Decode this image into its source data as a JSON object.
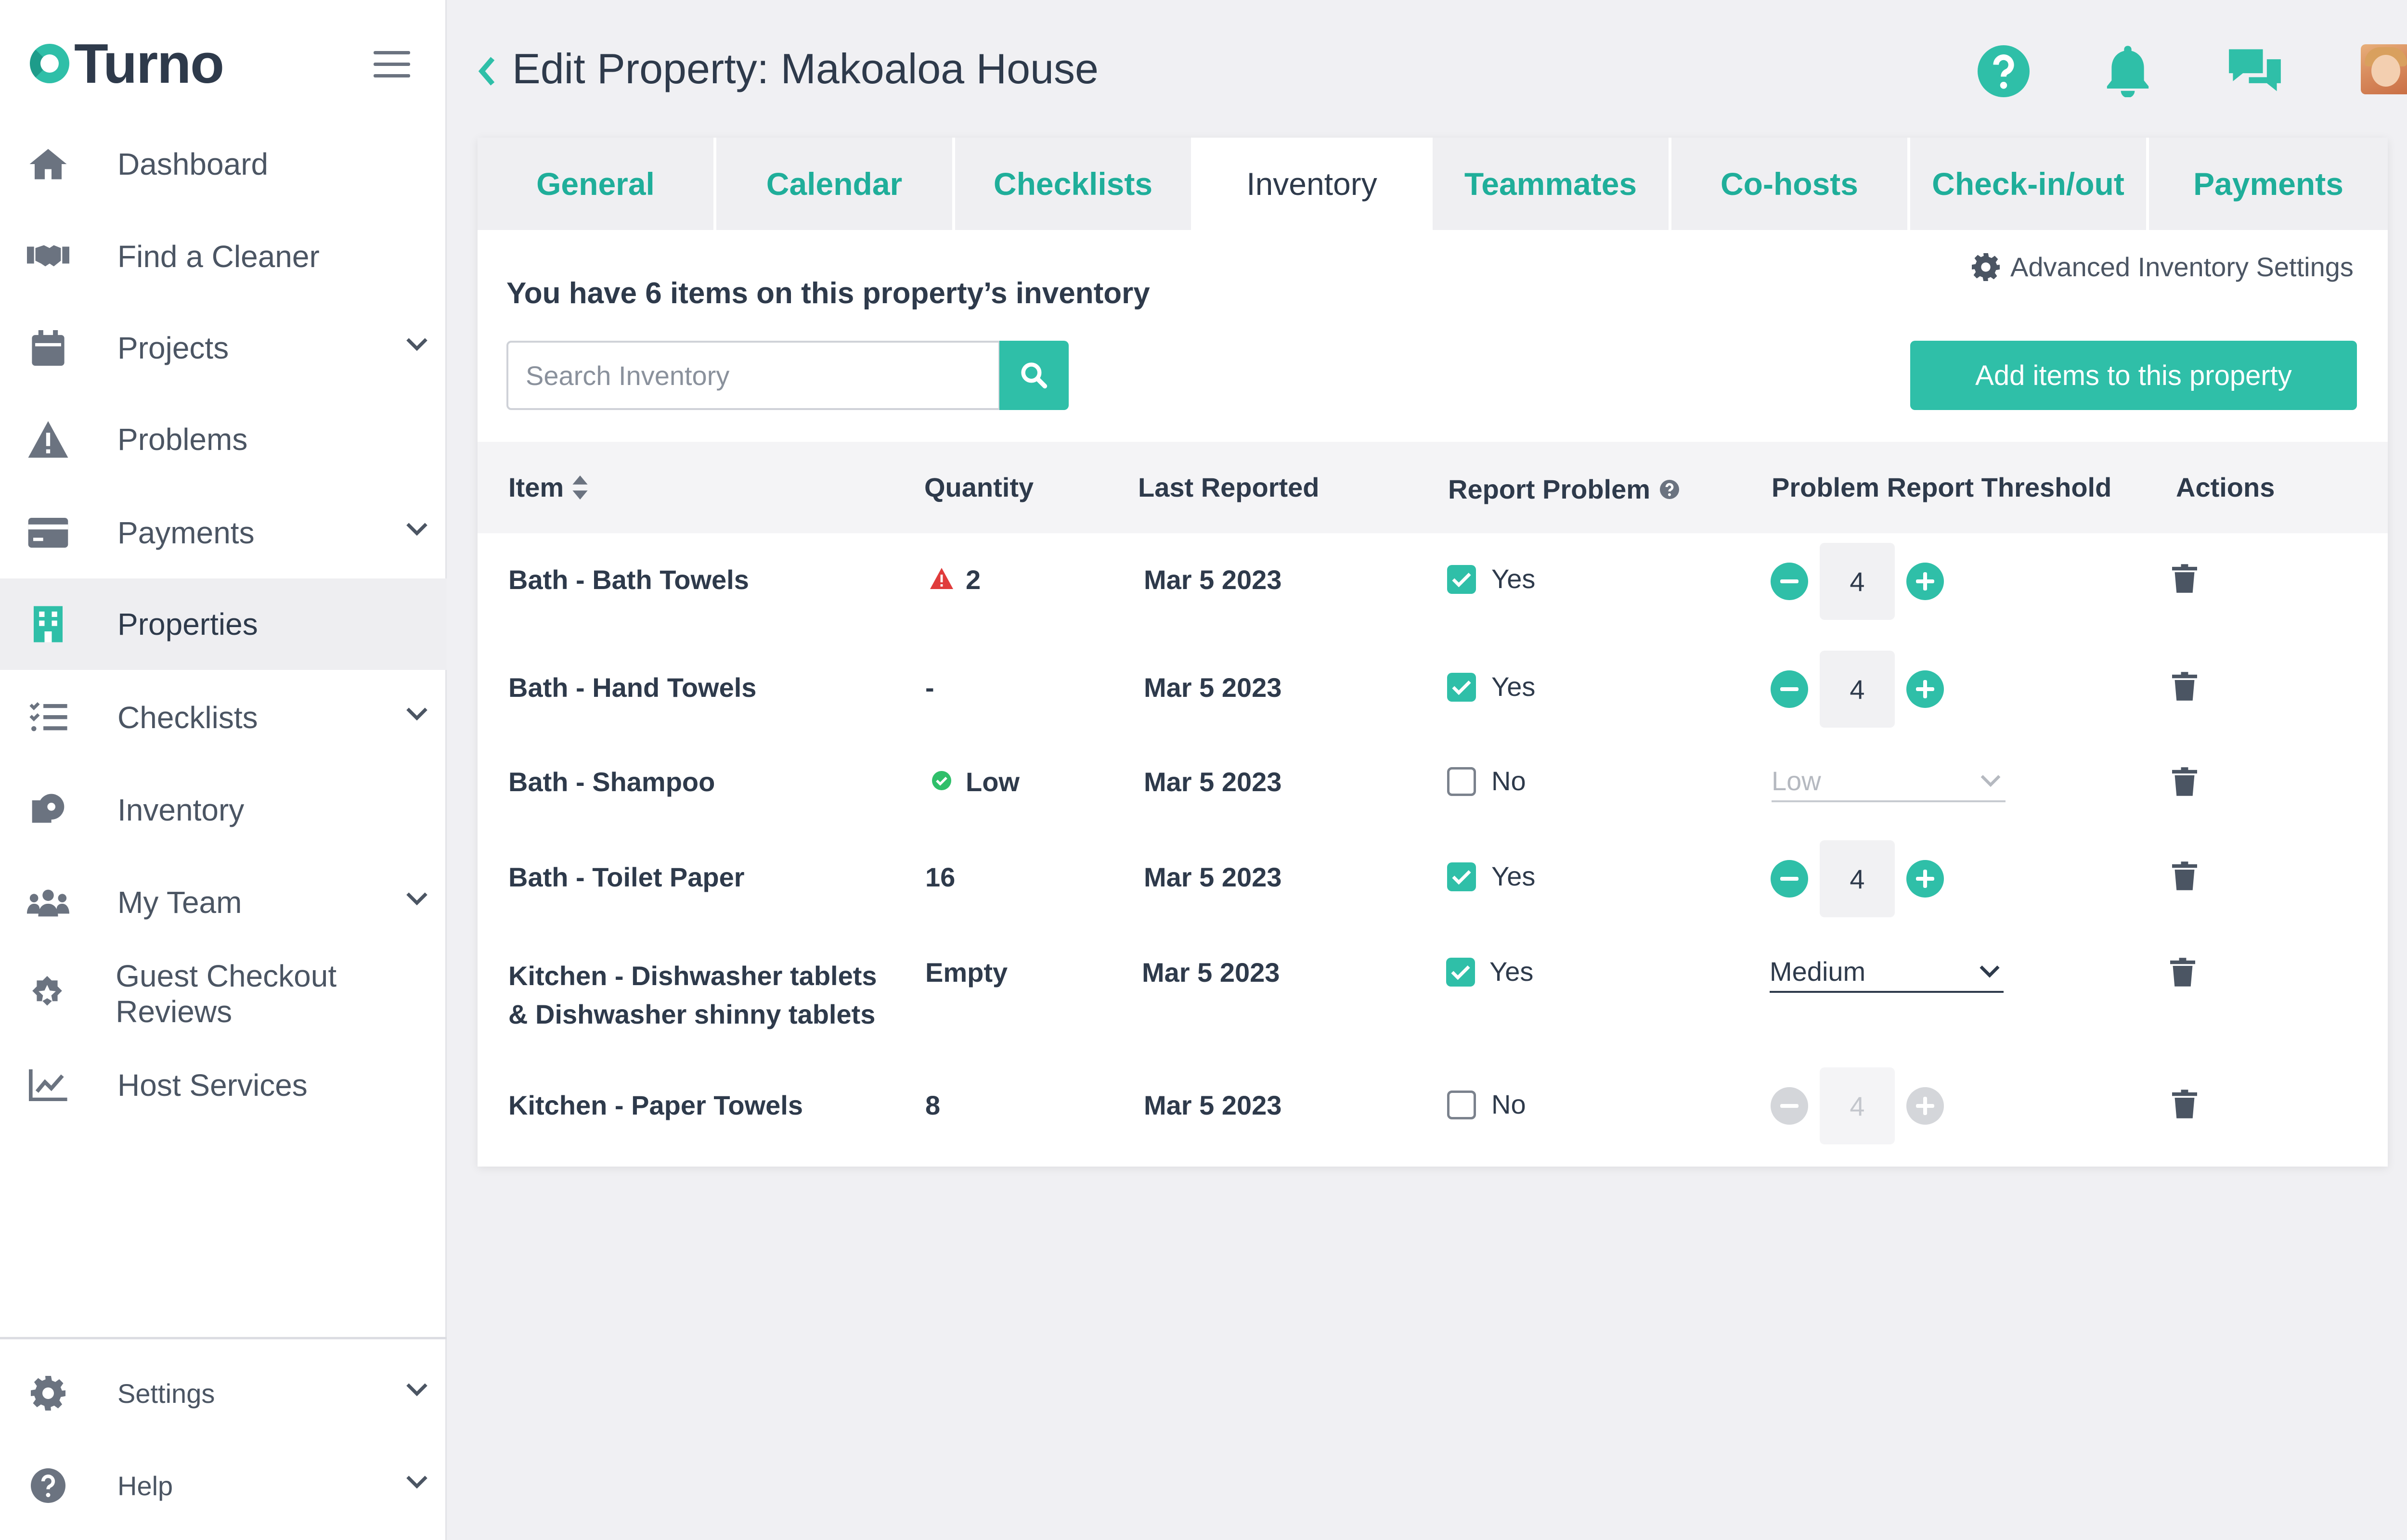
{
  "app": {
    "brand": "Turno"
  },
  "colors": {
    "accent": "#2fbfa8",
    "text": "#2e3a4b",
    "warning": "#e03b3b",
    "ok": "#2fbf6a"
  },
  "sidebar": {
    "items": [
      {
        "label": "Dashboard",
        "icon": "home-icon",
        "expandable": false
      },
      {
        "label": "Find a Cleaner",
        "icon": "handshake-icon",
        "expandable": false
      },
      {
        "label": "Projects",
        "icon": "calendar-icon",
        "expandable": true
      },
      {
        "label": "Problems",
        "icon": "warning-icon",
        "expandable": false
      },
      {
        "label": "Payments",
        "icon": "credit-card-icon",
        "expandable": true
      },
      {
        "label": "Properties",
        "icon": "building-icon",
        "expandable": false,
        "active": true
      },
      {
        "label": "Checklists",
        "icon": "checklist-icon",
        "expandable": true
      },
      {
        "label": "Inventory",
        "icon": "toilet-paper-icon",
        "expandable": false
      },
      {
        "label": "My Team",
        "icon": "team-icon",
        "expandable": true
      },
      {
        "label": "Guest Checkout Reviews",
        "icon": "star-badge-icon",
        "expandable": false
      },
      {
        "label": "Host Services",
        "icon": "chart-line-icon",
        "expandable": false
      }
    ],
    "bottom": [
      {
        "label": "Settings",
        "icon": "gear-icon",
        "expandable": true
      },
      {
        "label": "Help",
        "icon": "question-icon",
        "expandable": true
      }
    ]
  },
  "header": {
    "title": "Edit Property: Makoaloa House",
    "icons": [
      "help-icon",
      "bell-icon",
      "chat-icon",
      "avatar"
    ]
  },
  "tabs": [
    {
      "label": "General"
    },
    {
      "label": "Calendar"
    },
    {
      "label": "Checklists"
    },
    {
      "label": "Inventory",
      "active": true
    },
    {
      "label": "Teammates"
    },
    {
      "label": "Co-hosts"
    },
    {
      "label": "Check-in/out"
    },
    {
      "label": "Payments"
    }
  ],
  "inventory": {
    "advanced_settings": "Advanced Inventory Settings",
    "summary": "You have 6 items on this property’s inventory",
    "search_placeholder": "Search Inventory",
    "add_button": "Add items to this property",
    "columns": {
      "item": "Item",
      "quantity": "Quantity",
      "last_reported": "Last Reported",
      "report_problem": "Report Problem",
      "threshold": "Problem Report Threshold",
      "actions": "Actions"
    },
    "rows": [
      {
        "item": "Bath - Bath Towels",
        "quantity": "2",
        "quantity_icon": "warning-icon",
        "last_reported": "Mar 5 2023",
        "report": "Yes",
        "checked": true,
        "threshold_type": "stepper",
        "threshold": "4",
        "enabled": true
      },
      {
        "item": "Bath - Hand Towels",
        "quantity": "-",
        "last_reported": "Mar 5 2023",
        "report": "Yes",
        "checked": true,
        "threshold_type": "stepper",
        "threshold": "4",
        "enabled": true
      },
      {
        "item": "Bath - Shampoo",
        "quantity": "Low",
        "quantity_icon": "check-circle-icon",
        "last_reported": "Mar 5 2023",
        "report": "No",
        "checked": false,
        "threshold_type": "select",
        "threshold": "Low",
        "enabled": false
      },
      {
        "item": "Bath - Toilet Paper",
        "quantity": "16",
        "last_reported": "Mar 5 2023",
        "report": "Yes",
        "checked": true,
        "threshold_type": "stepper",
        "threshold": "4",
        "enabled": true
      },
      {
        "item_line1": "Kitchen - Dishwasher tablets",
        "item_line2": "& Dishwasher shinny tablets",
        "quantity": "Empty",
        "last_reported": "Mar 5 2023",
        "report": "Yes",
        "checked": true,
        "threshold_type": "select",
        "threshold": "Medium",
        "enabled": true
      },
      {
        "item": "Kitchen - Paper Towels",
        "quantity": "8",
        "last_reported": "Mar 5 2023",
        "report": "No",
        "checked": false,
        "threshold_type": "stepper",
        "threshold": "4",
        "enabled": false
      }
    ]
  }
}
